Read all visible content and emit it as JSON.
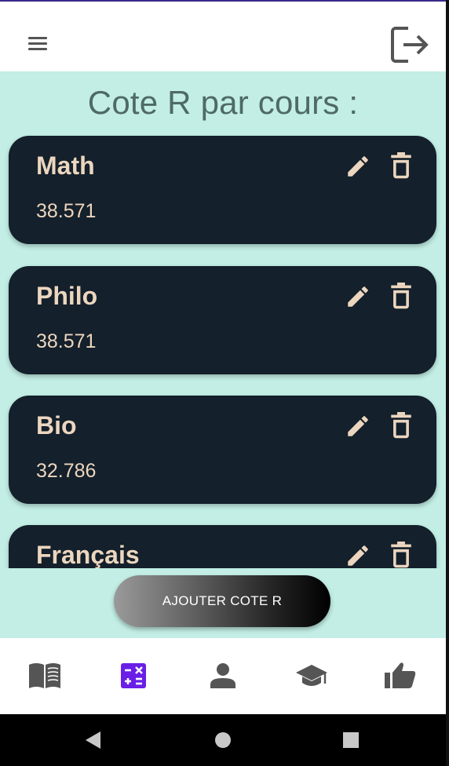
{
  "header": {
    "menu_icon": "hamburger-menu-icon",
    "logout_icon": "logout-icon"
  },
  "page": {
    "title": "Cote R par cours :"
  },
  "courses": [
    {
      "name": "Math",
      "value": "38.571"
    },
    {
      "name": "Philo",
      "value": "38.571"
    },
    {
      "name": "Bio",
      "value": "32.786"
    },
    {
      "name": "Français",
      "value": ""
    }
  ],
  "actions": {
    "add_label": "AJOUTER COTE R",
    "edit_icon": "pencil-icon",
    "delete_icon": "trash-icon"
  },
  "bottom_nav": {
    "items": [
      {
        "id": "courses",
        "icon": "book-open-icon",
        "active": false
      },
      {
        "id": "calculator",
        "icon": "calculator-icon",
        "active": true
      },
      {
        "id": "profile",
        "icon": "person-icon",
        "active": false
      },
      {
        "id": "school",
        "icon": "graduation-cap-icon",
        "active": false
      },
      {
        "id": "rate",
        "icon": "thumbs-up-icon",
        "active": false
      }
    ]
  },
  "colors": {
    "background": "#c2eee5",
    "card": "#14202b",
    "card_text": "#ecd6bf",
    "title_text": "#4f6a66",
    "active_nav": "#6a1ee6",
    "inactive_nav": "#555555"
  }
}
